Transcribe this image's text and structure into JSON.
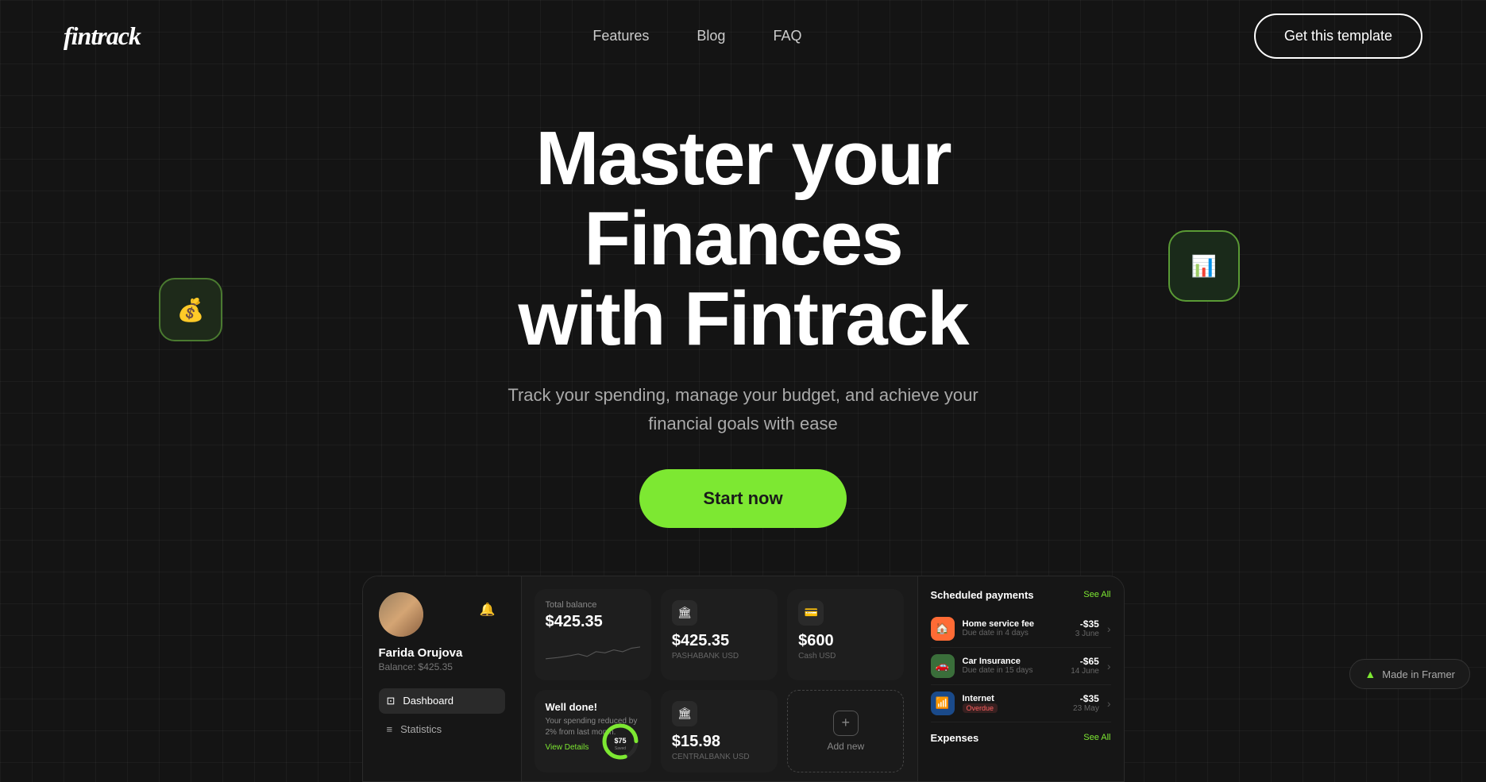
{
  "brand": {
    "logo": "fintrack"
  },
  "nav": {
    "links": [
      "Features",
      "Blog",
      "FAQ"
    ],
    "cta": "Get this template"
  },
  "hero": {
    "title_line1": "Master your Finances",
    "title_line2": "with Fintrack",
    "subtitle": "Track your spending, manage your budget, and achieve your financial goals with ease",
    "cta": "Start now"
  },
  "deco_left": {
    "icon": "💰"
  },
  "deco_right": {
    "icon": "📊"
  },
  "dashboard": {
    "user": {
      "name": "Farida Orujova",
      "balance_label": "Balance:",
      "balance": "$425.35"
    },
    "bell_icon": "🔔",
    "menu": [
      {
        "label": "Dashboard",
        "icon": "⊡",
        "active": true
      },
      {
        "label": "Statistics",
        "icon": "≡",
        "active": false
      }
    ],
    "cards": {
      "total_balance": {
        "label": "Total balance",
        "amount": "$425.35"
      },
      "bank1": {
        "amount": "$425.35",
        "bank": "PASHABANK USD"
      },
      "bank2": {
        "amount": "$600",
        "bank": "Cash USD"
      },
      "well_done": {
        "title": "Well done!",
        "sub": "Your spending reduced by 2% from last month.",
        "link": "View Details",
        "saved_amount": "$75",
        "saved_label": "Saved"
      },
      "bank3": {
        "amount": "$15.98",
        "bank": "CENTRALBANK USD"
      },
      "add_new": {
        "label": "Add new"
      }
    },
    "scheduled": {
      "title": "Scheduled payments",
      "see_all": "See All",
      "items": [
        {
          "name": "Home service fee",
          "due": "Due date in 4 days",
          "amount": "-$35",
          "date": "3 June",
          "icon": "🏠",
          "bg": "#ff6b35"
        },
        {
          "name": "Car Insurance",
          "due": "Due date in 15 days",
          "amount": "-$65",
          "date": "14 June",
          "icon": "🚗",
          "bg": "#5cb85c"
        },
        {
          "name": "Internet",
          "due": "Overdue",
          "amount": "-$35",
          "date": "23 May",
          "icon": "📶",
          "bg": "#4a90d9",
          "overdue": true
        }
      ],
      "expenses_title": "Expenses",
      "expenses_see_all": "See All"
    }
  },
  "framer_badge": {
    "label": "Made in Framer",
    "icon": "▲"
  }
}
